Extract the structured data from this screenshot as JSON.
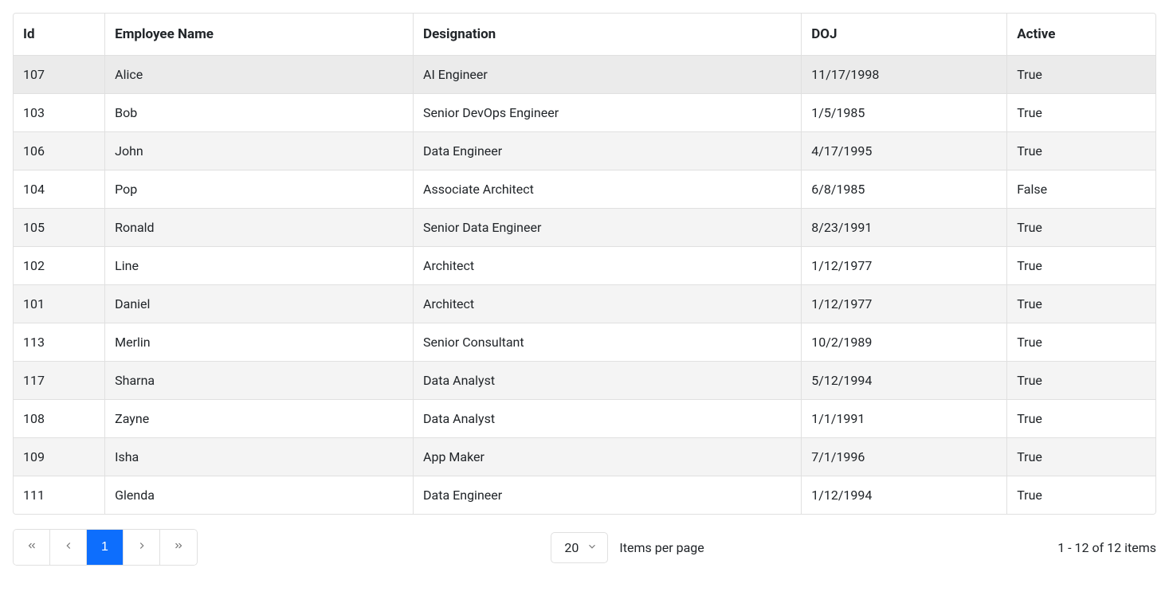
{
  "columns": {
    "id": "Id",
    "name": "Employee Name",
    "designation": "Designation",
    "doj": "DOJ",
    "active": "Active"
  },
  "rows": [
    {
      "id": "107",
      "name": "Alice",
      "designation": "AI Engineer",
      "doj": "11/17/1998",
      "active": "True"
    },
    {
      "id": "103",
      "name": "Bob",
      "designation": "Senior DevOps Engineer",
      "doj": "1/5/1985",
      "active": "True"
    },
    {
      "id": "106",
      "name": "John",
      "designation": "Data Engineer",
      "doj": "4/17/1995",
      "active": "True"
    },
    {
      "id": "104",
      "name": "Pop",
      "designation": "Associate Architect",
      "doj": "6/8/1985",
      "active": "False"
    },
    {
      "id": "105",
      "name": "Ronald",
      "designation": "Senior Data Engineer",
      "doj": "8/23/1991",
      "active": "True"
    },
    {
      "id": "102",
      "name": "Line",
      "designation": "Architect",
      "doj": "1/12/1977",
      "active": "True"
    },
    {
      "id": "101",
      "name": "Daniel",
      "designation": "Architect",
      "doj": "1/12/1977",
      "active": "True"
    },
    {
      "id": "113",
      "name": "Merlin",
      "designation": "Senior Consultant",
      "doj": "10/2/1989",
      "active": "True"
    },
    {
      "id": "117",
      "name": "Sharna",
      "designation": "Data Analyst",
      "doj": "5/12/1994",
      "active": "True"
    },
    {
      "id": "108",
      "name": "Zayne",
      "designation": "Data Analyst",
      "doj": "1/1/1991",
      "active": "True"
    },
    {
      "id": "109",
      "name": "Isha",
      "designation": "App Maker",
      "doj": "7/1/1996",
      "active": "True"
    },
    {
      "id": "111",
      "name": "Glenda",
      "designation": "Data Engineer",
      "doj": "1/12/1994",
      "active": "True"
    }
  ],
  "pager": {
    "current_page": "1",
    "page_size": "20",
    "items_per_page_label": "Items per page",
    "info": "1 - 12 of 12 items"
  }
}
